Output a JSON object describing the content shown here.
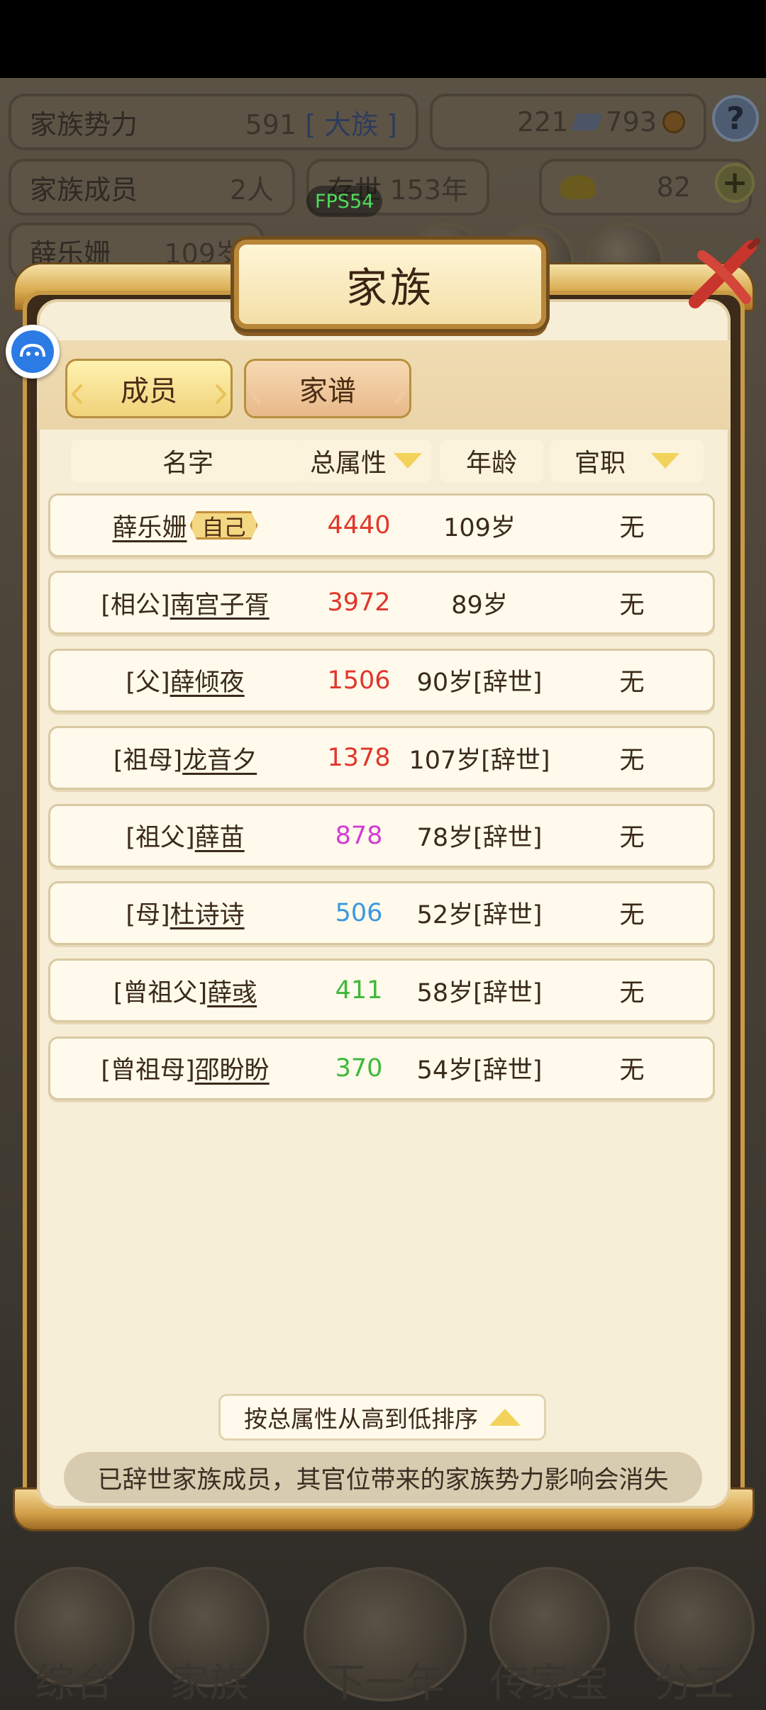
{
  "background": {
    "stats": {
      "family_power_label": "家族势力",
      "family_power_value": "591",
      "family_power_tag": "[ 大族 ]",
      "currency_a": "221",
      "currency_b": "793",
      "members_label": "家族成员",
      "members_value": "2人",
      "alive_label": "存世",
      "alive_value": "153年",
      "gold_value": "82",
      "top_person_name": "薛乐姗",
      "top_person_age": "109岁"
    },
    "fps_label": "FPS54",
    "bottom_nav": [
      {
        "label": "综合"
      },
      {
        "label": "家族"
      },
      {
        "label": "下一年"
      },
      {
        "label": "传家宝"
      },
      {
        "label": "分工"
      }
    ]
  },
  "dialog": {
    "title": "家族",
    "tabs": [
      {
        "label": "成员"
      },
      {
        "label": "家谱"
      }
    ],
    "columns": {
      "name": "名字",
      "total_attr": "总属性",
      "age": "年龄",
      "rank": "官职"
    },
    "self_badge": "自己",
    "rows": [
      {
        "prefix": "",
        "name": "薛乐姗",
        "attr": "4440",
        "attr_color": "#e0362c",
        "age": "109岁",
        "rank": "无"
      },
      {
        "prefix": "[相公]",
        "name": "南宫子胥",
        "attr": "3972",
        "attr_color": "#e0362c",
        "age": "89岁",
        "rank": "无"
      },
      {
        "prefix": "[父]",
        "name": "薛倾夜",
        "attr": "1506",
        "attr_color": "#e0362c",
        "age": "90岁[辞世]",
        "rank": "无"
      },
      {
        "prefix": "[祖母]",
        "name": "龙音夕",
        "attr": "1378",
        "attr_color": "#e0362c",
        "age": "107岁[辞世]",
        "rank": "无"
      },
      {
        "prefix": "[祖父]",
        "name": "薛苗",
        "attr": "878",
        "attr_color": "#d43ad6",
        "age": "78岁[辞世]",
        "rank": "无"
      },
      {
        "prefix": "[母]",
        "name": "杜诗诗",
        "attr": "506",
        "attr_color": "#3b97e0",
        "age": "52岁[辞世]",
        "rank": "无"
      },
      {
        "prefix": "[曾祖父]",
        "name": "薛彧",
        "attr": "411",
        "attr_color": "#3cb83a",
        "age": "58岁[辞世]",
        "rank": "无"
      },
      {
        "prefix": "[曾祖母]",
        "name": "邵盼盼",
        "attr": "370",
        "attr_color": "#3cb83a",
        "age": "54岁[辞世]",
        "rank": "无"
      }
    ],
    "sort_label": "按总属性从高到低排序",
    "notice": "已辞世家族成员，其官位带来的家族势力影响会消失"
  }
}
